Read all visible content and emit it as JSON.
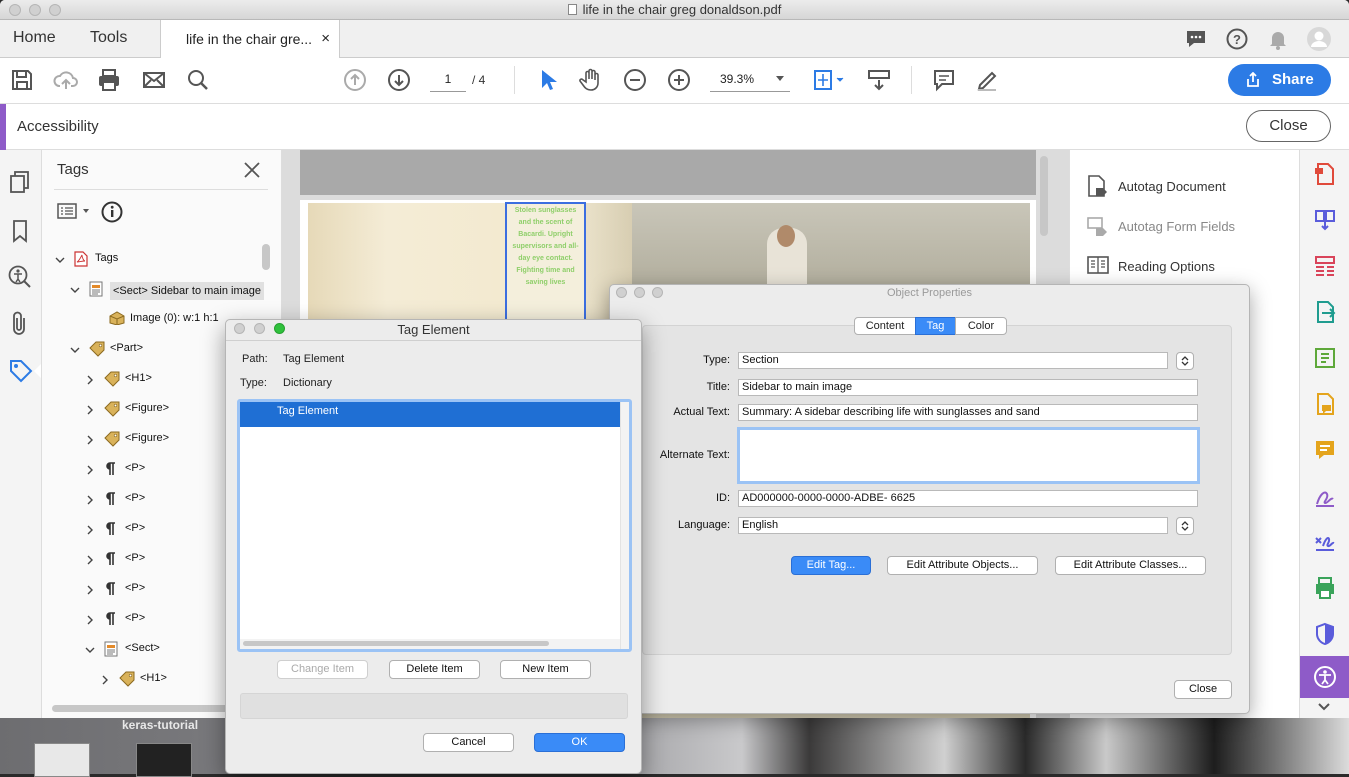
{
  "window": {
    "title": "life in the chair greg donaldson.pdf"
  },
  "tabs": {
    "home": "Home",
    "tools": "Tools",
    "doc_tab": "life in the chair gre...",
    "doc_tab_close": "×"
  },
  "toolbar": {
    "page_current": "1",
    "page_total": "/ 4",
    "zoom": "39.3%",
    "share": "Share"
  },
  "accessibility": {
    "title": "Accessibility",
    "close": "Close"
  },
  "tags_panel": {
    "title": "Tags",
    "items": [
      {
        "label": "Tags"
      },
      {
        "label": "<Sect> Sidebar to main image"
      },
      {
        "label": "Image (0): w:1 h:1"
      },
      {
        "label": "<Part>"
      },
      {
        "label": "<H1>"
      },
      {
        "label": "<Figure>"
      },
      {
        "label": "<Figure>"
      },
      {
        "label": "<P>"
      },
      {
        "label": "<P>"
      },
      {
        "label": "<P>"
      },
      {
        "label": "<P>"
      },
      {
        "label": "<P>"
      },
      {
        "label": "<P>"
      },
      {
        "label": "<Sect>"
      },
      {
        "label": "<H1>"
      }
    ]
  },
  "page_preview": {
    "sidebar_text": "Stolen sunglasses and the scent of Bacardi. Upright supervisors and all-day eye contact. Fighting time and saving lives"
  },
  "right_panel": {
    "items": [
      {
        "label": "Autotag Document"
      },
      {
        "label": "Autotag Form Fields"
      },
      {
        "label": "Reading Options"
      }
    ]
  },
  "object_properties": {
    "title": "Object Properties",
    "tabs": [
      "Content",
      "Tag",
      "Color"
    ],
    "active_tab": "Tag",
    "type_label": "Type:",
    "type_value": "Section",
    "title_label": "Title:",
    "title_value": "Sidebar to main image",
    "actual_text_label": "Actual Text:",
    "actual_text_value": "Summary: A sidebar describing life with sunglasses and sand",
    "alt_text_label": "Alternate Text:",
    "alt_text_value": "",
    "id_label": "ID:",
    "id_value": "AD000000-0000-0000-ADBE-        6625",
    "language_label": "Language:",
    "language_value": "English",
    "edit_tag": "Edit Tag...",
    "edit_attr_objects": "Edit Attribute Objects...",
    "edit_attr_classes": "Edit Attribute Classes...",
    "close": "Close"
  },
  "tag_element": {
    "title": "Tag Element",
    "path_label": "Path:",
    "path_value": "Tag Element",
    "type_label": "Type:",
    "type_value": "Dictionary",
    "list_selected": "Tag Element",
    "change_item": "Change Item",
    "delete_item": "Delete Item",
    "new_item": "New Item",
    "cancel": "Cancel",
    "ok": "OK"
  },
  "desktop": {
    "label": "keras-tutorial"
  },
  "colors": {
    "accent_blue": "#2c7be5",
    "accessibility_purple": "#8e5bc8",
    "selection_blue": "#1f6fd4"
  }
}
